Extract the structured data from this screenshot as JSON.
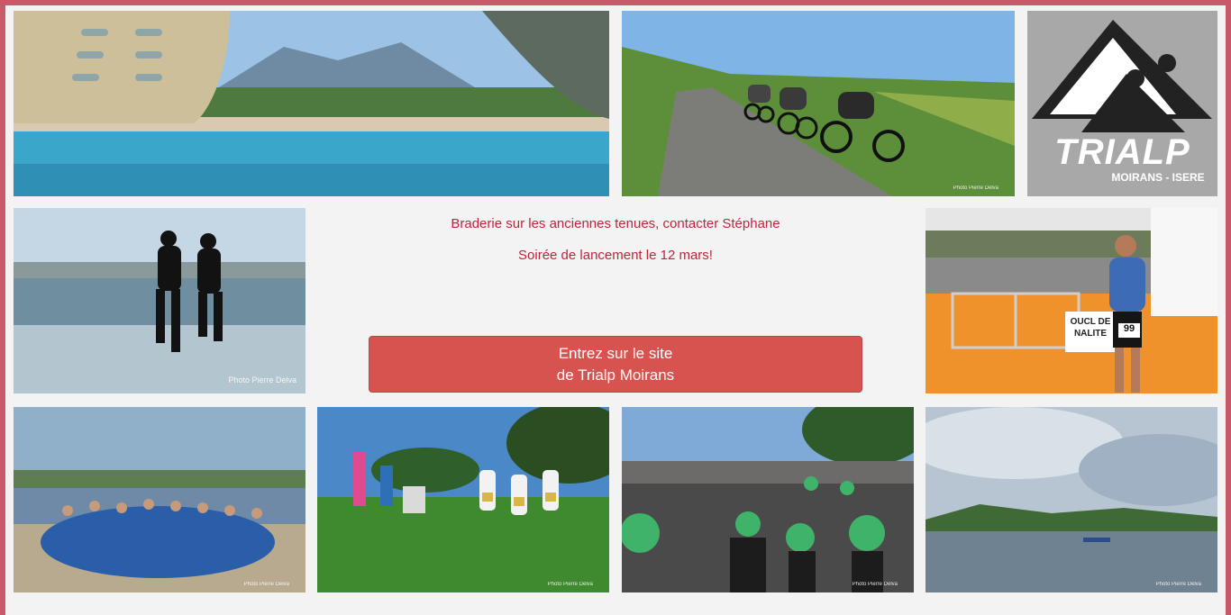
{
  "messages": {
    "line1": "Braderie sur les anciennes tenues, contacter Stéphane",
    "line2": "Soirée de lancement le 12 mars!"
  },
  "cta": {
    "line1": "Entrez sur le site",
    "line2": "de Trialp Moirans"
  },
  "logo": {
    "name": "TRIALP",
    "subtitle": "MOIRANS - ISERE"
  },
  "credits": {
    "delva": "Photo Pierre Delva",
    "delva_small": "Photo Pierre Delva",
    "race_bib": "99",
    "sign_text": "OUCL DE NALITE"
  },
  "colors": {
    "frame": "#c9586a",
    "message_text": "#c0243c",
    "button_bg": "#d6534f",
    "logo_bg": "#a8a8a8"
  }
}
